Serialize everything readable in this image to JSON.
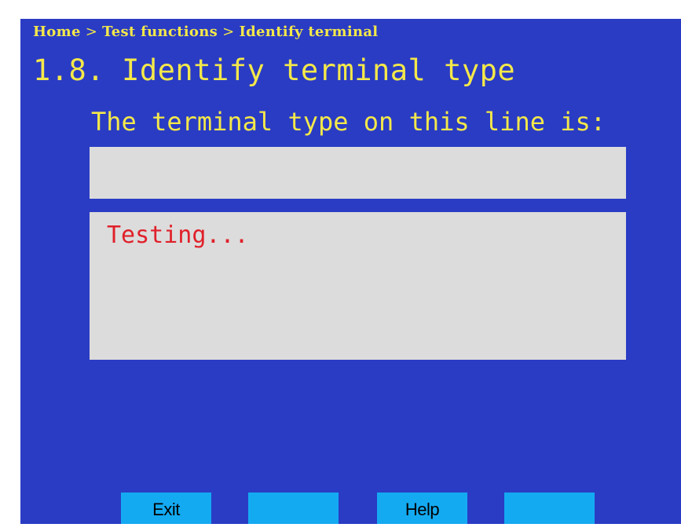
{
  "breadcrumb": {
    "items": [
      "Home",
      "Test functions",
      "Identify terminal"
    ],
    "separator": ">"
  },
  "title": {
    "number": "1.8.",
    "text": "Identify terminal type"
  },
  "prompt": "The terminal type on this line is:",
  "result": {
    "value": ""
  },
  "status": {
    "text": "Testing..."
  },
  "softkeys": [
    {
      "label": "Exit"
    },
    {
      "label": ""
    },
    {
      "label": "Help"
    },
    {
      "label": ""
    }
  ],
  "colors": {
    "screen_background": "#2a3cc4",
    "header_text": "#f4e84a",
    "field_background": "#dcdcdc",
    "status_text": "#e0202a",
    "softkey_background": "#14aaf2"
  }
}
